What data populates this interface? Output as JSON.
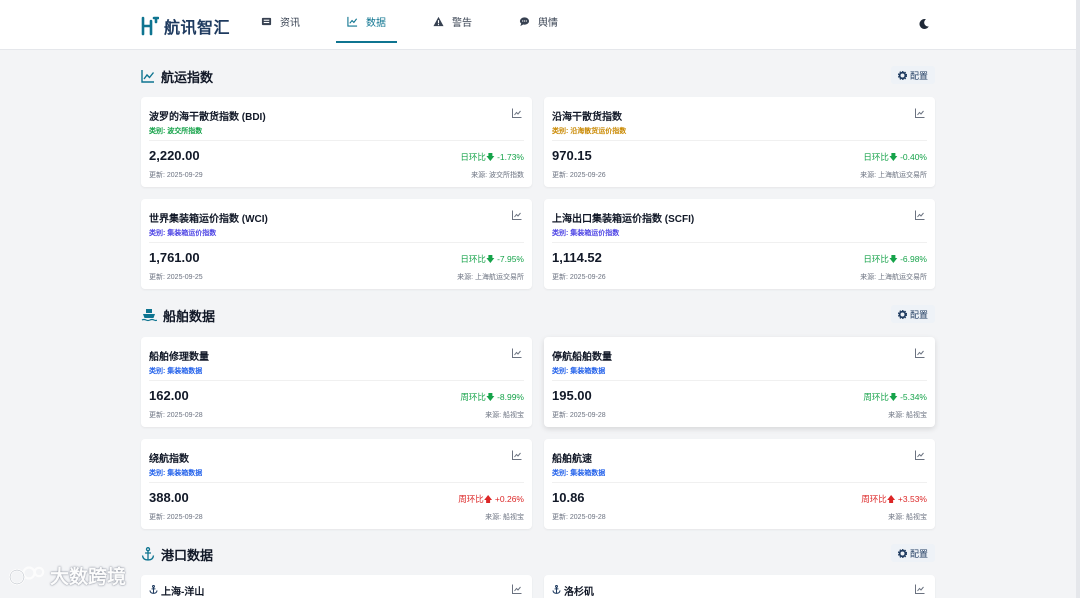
{
  "app": {
    "name": "航讯智汇",
    "brand_color": "#1e3a5f",
    "accent_color": "#0e7490"
  },
  "nav": [
    {
      "label": "资讯",
      "icon": "newspaper-icon",
      "active": false
    },
    {
      "label": "数据",
      "icon": "line-chart-icon",
      "active": true
    },
    {
      "label": "警告",
      "icon": "warning-icon",
      "active": false
    },
    {
      "label": "舆情",
      "icon": "comment-icon",
      "active": false
    }
  ],
  "theme_toggle_icon": "moon-icon",
  "sections": {
    "shipping_index": {
      "title": "航运指数",
      "icon": "trend-chart-icon",
      "config_label": "配置",
      "cards": [
        {
          "title": "波罗的海干散货指数 (BDI)",
          "category": "类别: 波交所指数",
          "category_color": "#16a34a",
          "value": "2,220.00",
          "change_label": "日环比",
          "change": "-1.73%",
          "direction": "down",
          "updated": "更新: 2025-09-29",
          "source": "来源: 波交所指数"
        },
        {
          "title": "沿海干散货指数",
          "category": "类别: 沿海散货运价指数",
          "category_color": "#ca8a04",
          "value": "970.15",
          "change_label": "日环比",
          "change": "-0.40%",
          "direction": "down",
          "updated": "更新: 2025-09-26",
          "source": "来源: 上海航运交易所"
        },
        {
          "title": "世界集装箱运价指数 (WCI)",
          "category": "类别: 集装箱运价指数",
          "category_color": "#4f46e5",
          "value": "1,761.00",
          "change_label": "日环比",
          "change": "-7.95%",
          "direction": "down",
          "updated": "更新: 2025-09-25",
          "source": "来源: 上海航运交易所"
        },
        {
          "title": "上海出口集装箱运价指数 (SCFI)",
          "category": "类别: 集装箱运价指数",
          "category_color": "#4f46e5",
          "value": "1,114.52",
          "change_label": "日环比",
          "change": "-6.98%",
          "direction": "down",
          "updated": "更新: 2025-09-26",
          "source": "来源: 上海航运交易所"
        }
      ]
    },
    "ship_data": {
      "title": "船舶数据",
      "icon": "ship-icon",
      "config_label": "配置",
      "cards": [
        {
          "title": "船舶修理数量",
          "category": "类别: 集装箱数据",
          "category_color": "#2563eb",
          "value": "162.00",
          "change_label": "周环比",
          "change": "-8.99%",
          "direction": "down",
          "updated": "更新: 2025-09-28",
          "source": "来源: 船视宝"
        },
        {
          "title": "停航船舶数量",
          "category": "类别: 集装箱数据",
          "category_color": "#2563eb",
          "value": "195.00",
          "change_label": "周环比",
          "change": "-5.34%",
          "direction": "down",
          "updated": "更新: 2025-09-28",
          "source": "来源: 船视宝"
        },
        {
          "title": "绕航指数",
          "category": "类别: 集装箱数据",
          "category_color": "#2563eb",
          "value": "388.00",
          "change_label": "周环比",
          "change": "+0.26%",
          "direction": "up",
          "updated": "更新: 2025-09-28",
          "source": "来源: 船视宝"
        },
        {
          "title": "船舶航速",
          "category": "类别: 集装箱数据",
          "category_color": "#2563eb",
          "value": "10.86",
          "change_label": "周环比",
          "change": "+3.53%",
          "direction": "up",
          "updated": "更新: 2025-09-28",
          "source": "来源: 船视宝"
        }
      ]
    },
    "port_data": {
      "title": "港口数据",
      "icon": "anchor-icon",
      "config_label": "配置",
      "cards": [
        {
          "title": "上海-洋山"
        },
        {
          "title": "洛杉矶"
        }
      ]
    }
  },
  "watermark": {
    "text": "大数跨境"
  }
}
